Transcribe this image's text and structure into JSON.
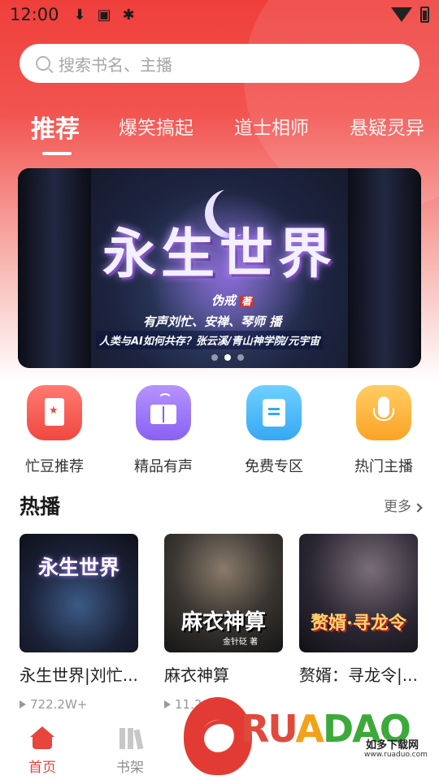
{
  "status": {
    "time": "12:00"
  },
  "search": {
    "placeholder": "搜索书名、主播"
  },
  "tabs": [
    {
      "label": "推荐",
      "active": true
    },
    {
      "label": "爆笑搞起"
    },
    {
      "label": "道士相师"
    },
    {
      "label": "悬疑灵异"
    }
  ],
  "banner": {
    "title": "永生世界",
    "author": "伪戒",
    "author_suffix": "著",
    "cast": "有声刘忙、安禅、琴师 播",
    "tagline": "人类与AI如何共存？张云溪/青山神学院/元宇宙",
    "slides": 3,
    "current_slide": 2
  },
  "categories": [
    {
      "label": "忙豆推荐",
      "icon": "bookmark-star-icon",
      "color": "#f0483f"
    },
    {
      "label": "精品有声",
      "icon": "audio-book-icon",
      "color": "#8861f2"
    },
    {
      "label": "免费专区",
      "icon": "book-card-icon",
      "color": "#35a8f2"
    },
    {
      "label": "热门主播",
      "icon": "microphone-icon",
      "color": "#fba325"
    }
  ],
  "hot": {
    "title": "热播",
    "more": "更多",
    "items": [
      {
        "cover_text": "永生世界",
        "cover_author": "",
        "name": "永生世界|刘忙...",
        "plays": "722.2W+"
      },
      {
        "cover_text": "麻衣神算",
        "cover_author": "金针砭 著",
        "name": "麻衣神算",
        "plays": "11.2..."
      },
      {
        "cover_text": "赘婿·寻龙令",
        "cover_author": "",
        "name": "赘婿：寻龙令|...",
        "plays": ""
      }
    ]
  },
  "tabbar": {
    "items": [
      {
        "label": "首页",
        "active": true
      },
      {
        "label": "书架"
      }
    ]
  },
  "watermark": {
    "brand": "RUANDAO",
    "cn": "如多下载网",
    "url": "www.ruaduo.com"
  },
  "colors": {
    "primary": "#e8453c",
    "header_gradient_top": "#ef3f3b"
  }
}
